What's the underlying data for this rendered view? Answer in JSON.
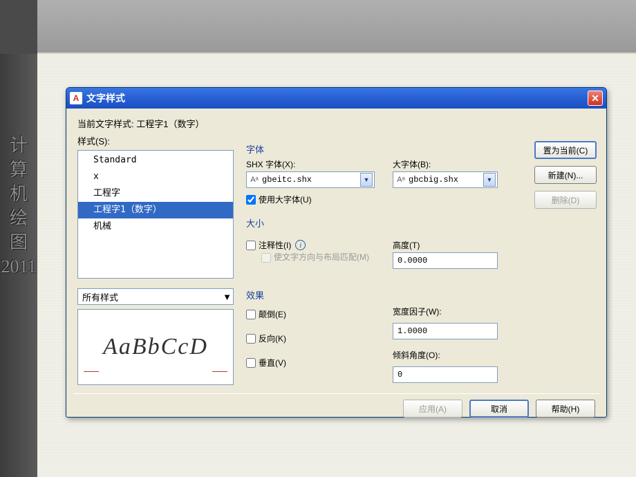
{
  "page_context": {
    "topbar": true,
    "left_strip_chars": [
      "计",
      "算",
      "机",
      "绘",
      "图",
      "2011"
    ]
  },
  "dialog": {
    "title": "文字样式",
    "appicon_letter": "A",
    "current_label": "当前文字样式:",
    "current_value": "工程字1（数字）",
    "styles_label": "样式(S):",
    "styles_items": [
      "Standard",
      "x",
      "工程字",
      "工程字1（数字）",
      "机械"
    ],
    "styles_selected_index": 3,
    "filter_label": "所有样式",
    "preview_text": "AaBbCcD",
    "font": {
      "group_title": "字体",
      "shx_label": "SHX 字体(X):",
      "shx_value": "gbeitc.shx",
      "bigfont_label": "大字体(B):",
      "bigfont_value": "gbcbig.shx",
      "use_bigfont_label": "使用大字体(U)",
      "use_bigfont_checked": true
    },
    "size": {
      "group_title": "大小",
      "annotative_label": "注释性(I)",
      "annotative_checked": false,
      "match_orient_label": "使文字方向与布局匹配(M)",
      "height_label": "高度(T)",
      "height_value": "0.0000"
    },
    "effects": {
      "group_title": "效果",
      "upside_down_label": "颠倒(E)",
      "backwards_label": "反向(K)",
      "vertical_label": "垂直(V)",
      "width_factor_label": "宽度因子(W):",
      "width_factor_value": "1.0000",
      "oblique_label": "倾斜角度(O):",
      "oblique_value": "0"
    },
    "buttons": {
      "set_current": "置为当前(C)",
      "new": "新建(N)...",
      "delete": "删除(D)",
      "apply": "应用(A)",
      "cancel": "取消",
      "help": "帮助(H)"
    }
  }
}
